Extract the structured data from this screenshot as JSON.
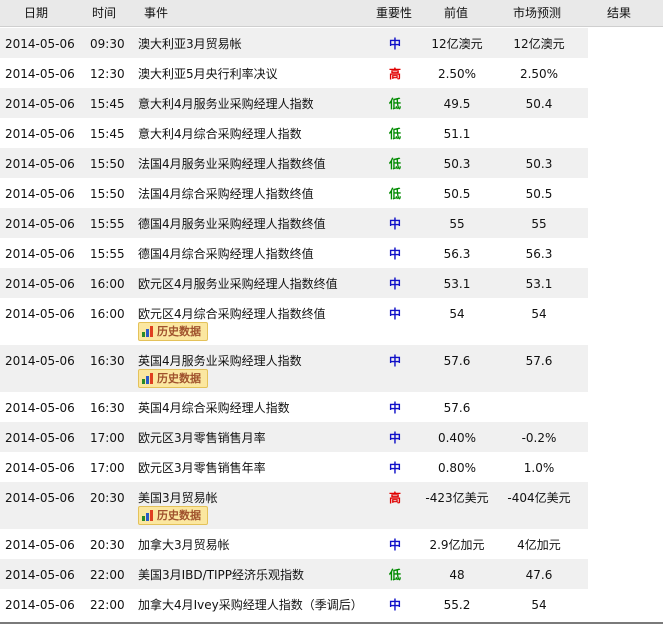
{
  "header": {
    "date": "日期",
    "time": "时间",
    "event": "事件",
    "importance": "重要性",
    "previous": "前值",
    "forecast": "市场预测",
    "result": "结果"
  },
  "history_label": "历史数据",
  "colors": {
    "high": "#e00000",
    "mid": "#1010c8",
    "low": "#008a00",
    "badge_bg": "#fbe7a0"
  },
  "rows": [
    {
      "date": "2014-05-06",
      "time": "09:30",
      "event": "澳大利亚3月贸易帐",
      "importance": "中",
      "level": "mid",
      "previous": "12亿澳元",
      "forecast": "12亿澳元",
      "history": false
    },
    {
      "date": "2014-05-06",
      "time": "12:30",
      "event": "澳大利亚5月央行利率决议",
      "importance": "高",
      "level": "high",
      "previous": "2.50%",
      "forecast": "2.50%",
      "history": false
    },
    {
      "date": "2014-05-06",
      "time": "15:45",
      "event": "意大利4月服务业采购经理人指数",
      "importance": "低",
      "level": "low",
      "previous": "49.5",
      "forecast": "50.4",
      "history": false
    },
    {
      "date": "2014-05-06",
      "time": "15:45",
      "event": "意大利4月综合采购经理人指数",
      "importance": "低",
      "level": "low",
      "previous": "51.1",
      "forecast": "",
      "history": false
    },
    {
      "date": "2014-05-06",
      "time": "15:50",
      "event": "法国4月服务业采购经理人指数终值",
      "importance": "低",
      "level": "low",
      "previous": "50.3",
      "forecast": "50.3",
      "history": false
    },
    {
      "date": "2014-05-06",
      "time": "15:50",
      "event": "法国4月综合采购经理人指数终值",
      "importance": "低",
      "level": "low",
      "previous": "50.5",
      "forecast": "50.5",
      "history": false
    },
    {
      "date": "2014-05-06",
      "time": "15:55",
      "event": "德国4月服务业采购经理人指数终值",
      "importance": "中",
      "level": "mid",
      "previous": "55",
      "forecast": "55",
      "history": false
    },
    {
      "date": "2014-05-06",
      "time": "15:55",
      "event": "德国4月综合采购经理人指数终值",
      "importance": "中",
      "level": "mid",
      "previous": "56.3",
      "forecast": "56.3",
      "history": false
    },
    {
      "date": "2014-05-06",
      "time": "16:00",
      "event": "欧元区4月服务业采购经理人指数终值",
      "importance": "中",
      "level": "mid",
      "previous": "53.1",
      "forecast": "53.1",
      "history": false
    },
    {
      "date": "2014-05-06",
      "time": "16:00",
      "event": "欧元区4月综合采购经理人指数终值",
      "importance": "中",
      "level": "mid",
      "previous": "54",
      "forecast": "54",
      "history": true
    },
    {
      "date": "2014-05-06",
      "time": "16:30",
      "event": "英国4月服务业采购经理人指数",
      "importance": "中",
      "level": "mid",
      "previous": "57.6",
      "forecast": "57.6",
      "history": true
    },
    {
      "date": "2014-05-06",
      "time": "16:30",
      "event": "英国4月综合采购经理人指数",
      "importance": "中",
      "level": "mid",
      "previous": "57.6",
      "forecast": "",
      "history": false
    },
    {
      "date": "2014-05-06",
      "time": "17:00",
      "event": "欧元区3月零售销售月率",
      "importance": "中",
      "level": "mid",
      "previous": "0.40%",
      "forecast": "-0.2%",
      "history": false
    },
    {
      "date": "2014-05-06",
      "time": "17:00",
      "event": "欧元区3月零售销售年率",
      "importance": "中",
      "level": "mid",
      "previous": "0.80%",
      "forecast": "1.0%",
      "history": false
    },
    {
      "date": "2014-05-06",
      "time": "20:30",
      "event": "美国3月贸易帐",
      "importance": "高",
      "level": "high",
      "previous": "-423亿美元",
      "forecast": "-404亿美元",
      "history": true
    },
    {
      "date": "2014-05-06",
      "time": "20:30",
      "event": "加拿大3月贸易帐",
      "importance": "中",
      "level": "mid",
      "previous": "2.9亿加元",
      "forecast": "4亿加元",
      "history": false
    },
    {
      "date": "2014-05-06",
      "time": "22:00",
      "event": "美国3月IBD/TIPP经济乐观指数",
      "importance": "低",
      "level": "low",
      "previous": "48",
      "forecast": "47.6",
      "history": false
    },
    {
      "date": "2014-05-06",
      "time": "22:00",
      "event": "加拿大4月Ivey采购经理人指数（季调后）",
      "importance": "中",
      "level": "mid",
      "previous": "55.2",
      "forecast": "54",
      "history": false
    }
  ]
}
